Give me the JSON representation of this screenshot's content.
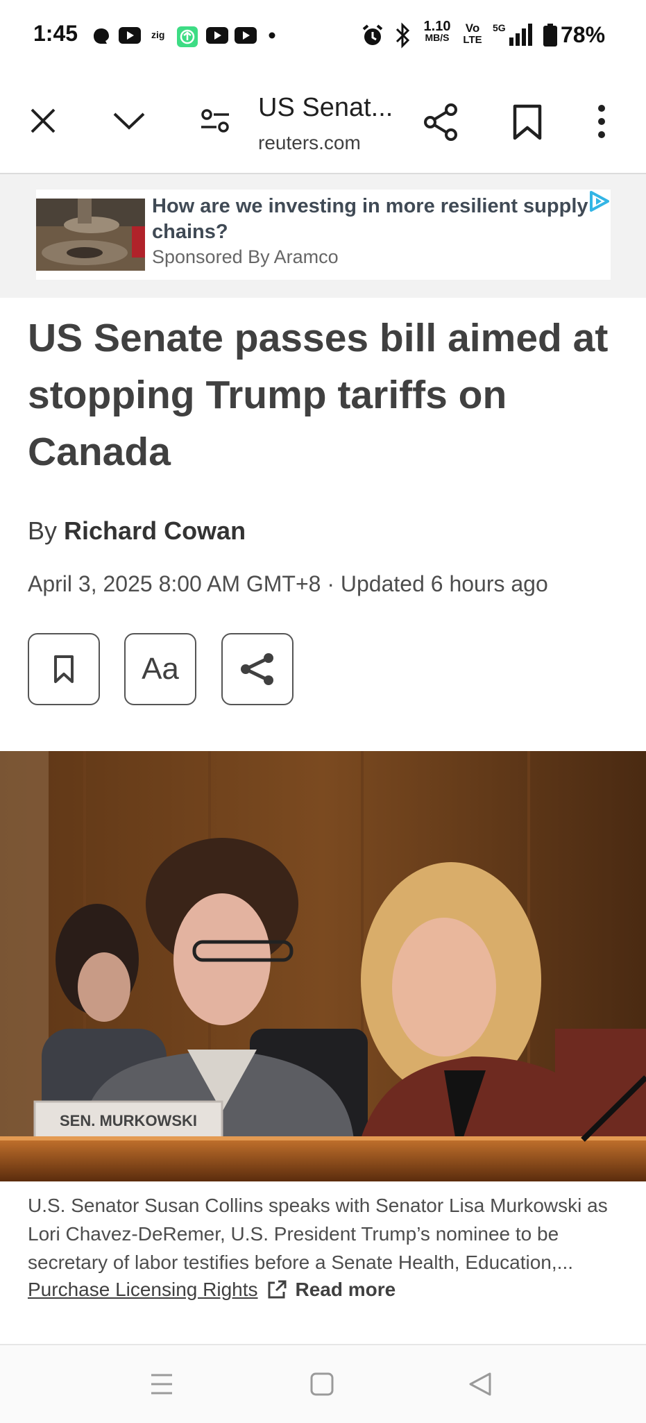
{
  "status_bar": {
    "time": "1:45",
    "net_speed_value": "1.10",
    "net_speed_unit": "MB/S",
    "volte_top": "Vo",
    "volte_bottom": "LTE",
    "network": "5G",
    "battery": "78%",
    "notification_icons": [
      "threads-icon",
      "youtube-icon",
      "zig-icon",
      "green-app-icon",
      "youtube-icon",
      "youtube-icon",
      "dot-icon"
    ]
  },
  "toolbar": {
    "title": "US Senat...",
    "domain": "reuters.com"
  },
  "ad": {
    "headline": "How are we investing in more resilient supply chains?",
    "sponsor": "Sponsored By Aramco"
  },
  "article": {
    "headline": "US Senate passes bill aimed at stopping Trump tariffs on Canada",
    "byline_prefix": "By",
    "author": "Richard Cowan",
    "dateline": "April 3, 2025 8:00 AM GMT+8 · Updated 6 hours ago",
    "text_size_label": "Aa",
    "nameplate_text": "SEN. MURKOWSKI",
    "caption": "U.S. Senator Susan Collins speaks with Senator Lisa Murkowski as Lori Chavez-DeRemer, U.S. President Trump’s nominee to be secretary of labor testifies before a Senate Health, Education,...",
    "licensing_label": "Purchase Licensing Rights",
    "read_more_label": "Read more"
  },
  "colors": {
    "text_dark": "#404040",
    "ad_background": "#f2f2f2",
    "adchoices": "#33b5e5",
    "wood": "#7a3e17"
  }
}
